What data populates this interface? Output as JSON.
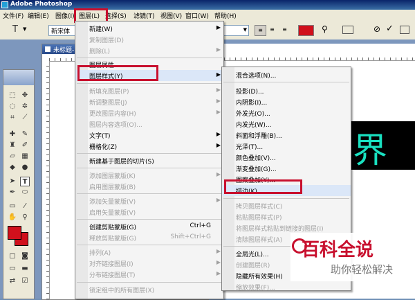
{
  "window": {
    "app_title": "Adobe Photoshop"
  },
  "menubar": [
    "文件(F)",
    "编辑(E)",
    "图像(I)",
    "图层(L)",
    "选择(S)",
    "滤镜(T)",
    "视图(V)",
    "窗口(W)",
    "帮助(H)"
  ],
  "options": {
    "font_family": "新宋体",
    "text_icon": "T"
  },
  "document": {
    "tab_title": "未标题-1"
  },
  "canvas_text": "界辉",
  "layer_menu": {
    "new": "新建(W)",
    "duplicate": "复制图层(D)",
    "delete": "删除(L)",
    "properties": "图层属性",
    "layer_style": "图层样式(Y)",
    "new_fill": "新填充图层(P)",
    "new_adjust": "新调整图层(J)",
    "change_content": "更改图层内容(H)",
    "content_options": "图层内容选项(O)...",
    "type": "文字(T)",
    "rasterize": "栅格化(Z)",
    "slice": "新建基于图层的切片(S)",
    "add_mask": "添加图层蒙版(K)",
    "enable_mask": "启用图层蒙版(B)",
    "add_vector_mask": "添加矢量蒙版(V)",
    "enable_vector_mask": "启用矢量蒙版(V)",
    "create_clip": "创建剪贴蒙版(G)",
    "create_clip_sc": "Ctrl+G",
    "release_clip": "释放剪贴蒙版(G)",
    "release_clip_sc": "Shift+Ctrl+G",
    "arrange": "排列(A)",
    "align": "对齐链接图层(I)",
    "distribute": "分布链接图层(T)",
    "lock": "锁定组中的所有图层(X)"
  },
  "style_menu": {
    "blend": "混合选项(N)...",
    "shadow": "投影(D)...",
    "inner_shadow": "内阴影(I)...",
    "outer_glow": "外发光(O)...",
    "inner_glow": "内发光(W)...",
    "bevel": "斜面和浮雕(B)...",
    "satin": "光泽(T)...",
    "color_overlay": "颜色叠加(V)...",
    "gradient_overlay": "渐变叠加(G)...",
    "pattern_overlay": "图案叠加(Y)...",
    "stroke": "描边(K)...",
    "copy_style": "拷贝图层样式(C)",
    "paste_style": "粘贴图层样式(P)",
    "paste_linked": "将图层样式粘贴到链接的图层(I)",
    "clear_style": "清除图层样式(A)",
    "global_light": "全局光(L)...",
    "create_layer": "创建图层(R)",
    "hide_effects": "隐藏所有效果(H)",
    "scale_effects": "缩放效果(F)..."
  },
  "watermark": {
    "main": "百科全说",
    "sub": "助你轻松解决"
  },
  "colors": {
    "highlight_red": "#c8102e",
    "canvas_text": "#19e0c0",
    "swatch_red": "#d0101c"
  }
}
